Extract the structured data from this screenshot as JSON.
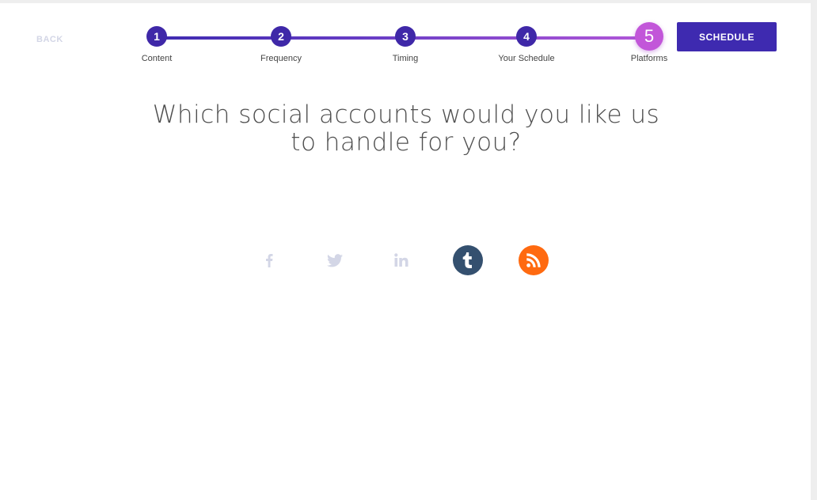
{
  "header": {
    "back_label": "BACK",
    "schedule_label": "SCHEDULE"
  },
  "steps": [
    {
      "number": "1",
      "label": "Content",
      "active": false
    },
    {
      "number": "2",
      "label": "Frequency",
      "active": false
    },
    {
      "number": "3",
      "label": "Timing",
      "active": false
    },
    {
      "number": "4",
      "label": "Your Schedule",
      "active": false
    },
    {
      "number": "5",
      "label": "Platforms",
      "active": true
    }
  ],
  "main": {
    "question_line1": "Which social accounts would you like us",
    "question_line2": "to handle for you?"
  },
  "platforms": [
    {
      "name": "facebook",
      "icon": "facebook-icon",
      "selected": false
    },
    {
      "name": "twitter",
      "icon": "twitter-icon",
      "selected": false
    },
    {
      "name": "linkedin",
      "icon": "linkedin-icon",
      "selected": false
    },
    {
      "name": "tumblr",
      "icon": "tumblr-icon",
      "selected": true,
      "color": "#34506f"
    },
    {
      "name": "rss",
      "icon": "rss-icon",
      "selected": true,
      "color": "#ff6a10"
    }
  ],
  "colors": {
    "primary": "#3e2ab0",
    "active_step": "#c256d9",
    "inactive_icon": "#d3d6e6"
  }
}
